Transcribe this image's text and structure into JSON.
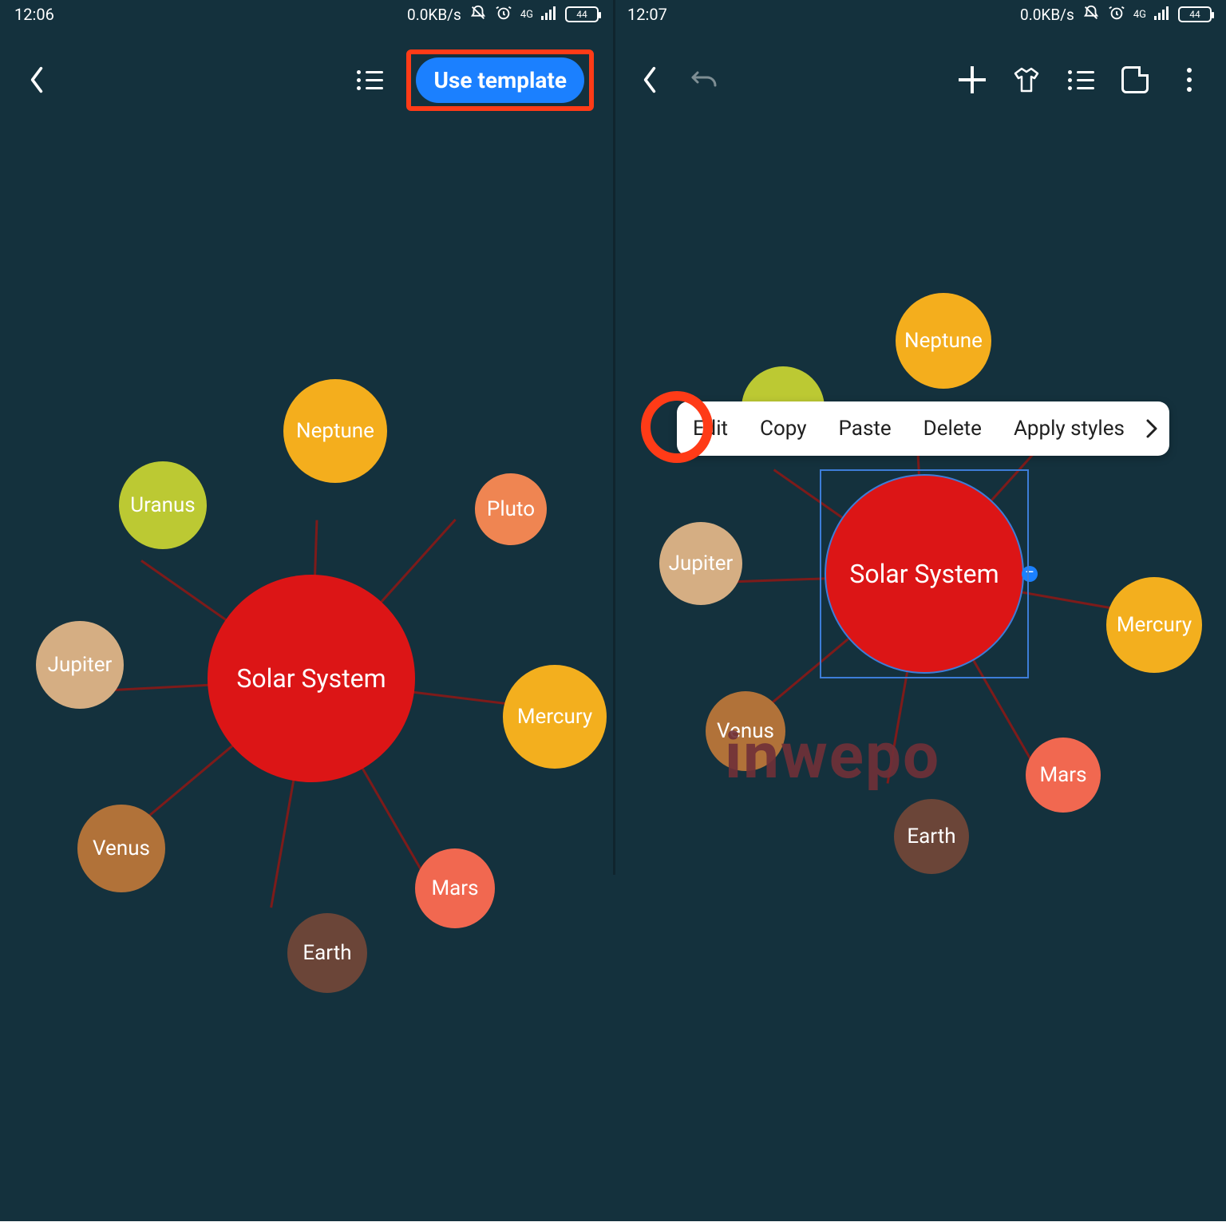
{
  "status": {
    "left_time": "12:06",
    "right_time": "12:07",
    "speed": "0.0KB/s",
    "network": "4G",
    "battery": "44"
  },
  "left_header": {
    "cta": "Use template"
  },
  "mindmap": {
    "center": "Solar System",
    "nodes": {
      "neptune": "Neptune",
      "uranus": "Uranus",
      "pluto": "Pluto",
      "jupiter": "Jupiter",
      "mercury": "Mercury",
      "venus": "Venus",
      "earth": "Earth",
      "mars": "Mars"
    }
  },
  "context_menu": {
    "edit": "Edit",
    "copy": "Copy",
    "paste": "Paste",
    "delete": "Delete",
    "apply": "Apply styles"
  },
  "watermark": "inwepo"
}
